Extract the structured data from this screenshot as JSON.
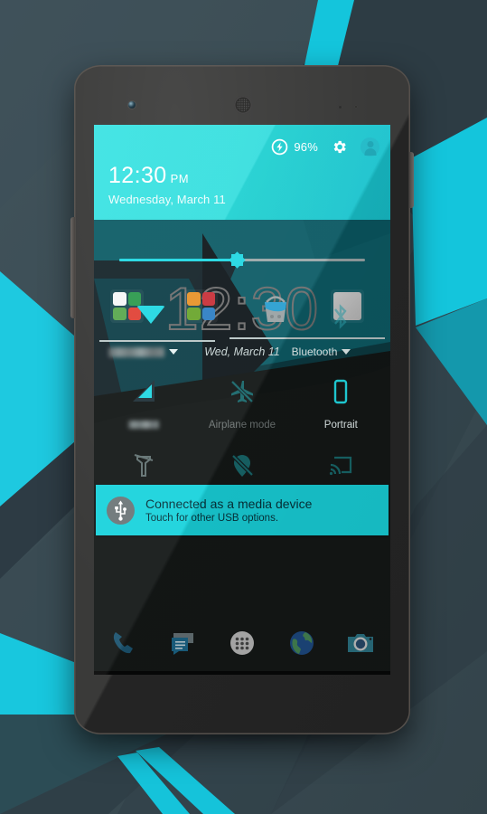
{
  "background": {
    "base_color": "#3a4b53",
    "accent_color": "#14c8dc",
    "dark_color": "#2b3940"
  },
  "device": {
    "name": "nexus-5-phone",
    "front_camera": "front-camera",
    "earpiece": "earpiece-speaker",
    "sensors": "proximity-sensor",
    "volume_rocker": "volume-rocker",
    "power_button": "power-button"
  },
  "status_panel": {
    "battery_percent": "96%",
    "battery_icon": "charging-bolt-icon",
    "settings_icon": "gear-icon",
    "user_icon": "user-avatar-icon",
    "time": "12:30",
    "meridiem": "PM",
    "date": "Wednesday, March 11",
    "background_color": "#22dcdb",
    "text_color": "#ffffff"
  },
  "brightness": {
    "label": "brightness-slider",
    "value": 48,
    "track_color": "#9aa7a9",
    "fill_color": "#22d8e2"
  },
  "clock_widget": {
    "time": "12:30",
    "wifi_icon": "wifi-icon",
    "bluetooth_icon": "bluetooth-icon",
    "stroke_color": "#6e6e6e"
  },
  "quick_settings": {
    "row0": {
      "carrier_name_redacted": "",
      "carrier_chevron": "chevron-down-icon",
      "date_text": "Wed, March 11",
      "bluetooth_label": "Bluetooth",
      "bluetooth_chevron": "chevron-down-icon"
    },
    "tiles": [
      {
        "label": "",
        "icon": "signal-bars-icon",
        "state": "on",
        "redacted": true
      },
      {
        "label": "Airplane mode",
        "icon": "airplane-off-icon",
        "state": "off"
      },
      {
        "label": "Portrait",
        "icon": "portrait-phone-icon",
        "state": "on"
      },
      {
        "label": "Flashlight",
        "icon": "flashlight-off-icon",
        "state": "off"
      },
      {
        "label": "Location Off",
        "icon": "location-off-icon",
        "state": "off"
      },
      {
        "label": "Cast screen",
        "icon": "cast-screen-icon",
        "state": "off"
      }
    ]
  },
  "notification": {
    "icon": "usb-icon",
    "title": "Connected as a media device",
    "subtitle": "Touch for other USB options.",
    "background_color": "#19d3dc",
    "text_color": "#06323a"
  },
  "homescreen": {
    "folders": [
      {
        "name": "google-folder",
        "apps": [
          "google-icon",
          "chrome-icon",
          "maps-icon",
          "gmail-icon"
        ]
      },
      {
        "name": "media-folder",
        "apps": [
          "headphones-icon",
          "movies-icon",
          "games-icon",
          "books-icon"
        ]
      },
      {
        "name": "play-store-folder",
        "apps": [
          "play-store-icon"
        ]
      }
    ],
    "theme_icon": "paint-bucket-icon",
    "dock": [
      {
        "name": "phone-app",
        "icon": "phone-icon"
      },
      {
        "name": "messaging-app",
        "icon": "message-icon"
      },
      {
        "name": "app-drawer",
        "icon": "apps-grid-icon"
      },
      {
        "name": "browser-app",
        "icon": "globe-icon"
      },
      {
        "name": "camera-app",
        "icon": "camera-icon"
      }
    ]
  }
}
